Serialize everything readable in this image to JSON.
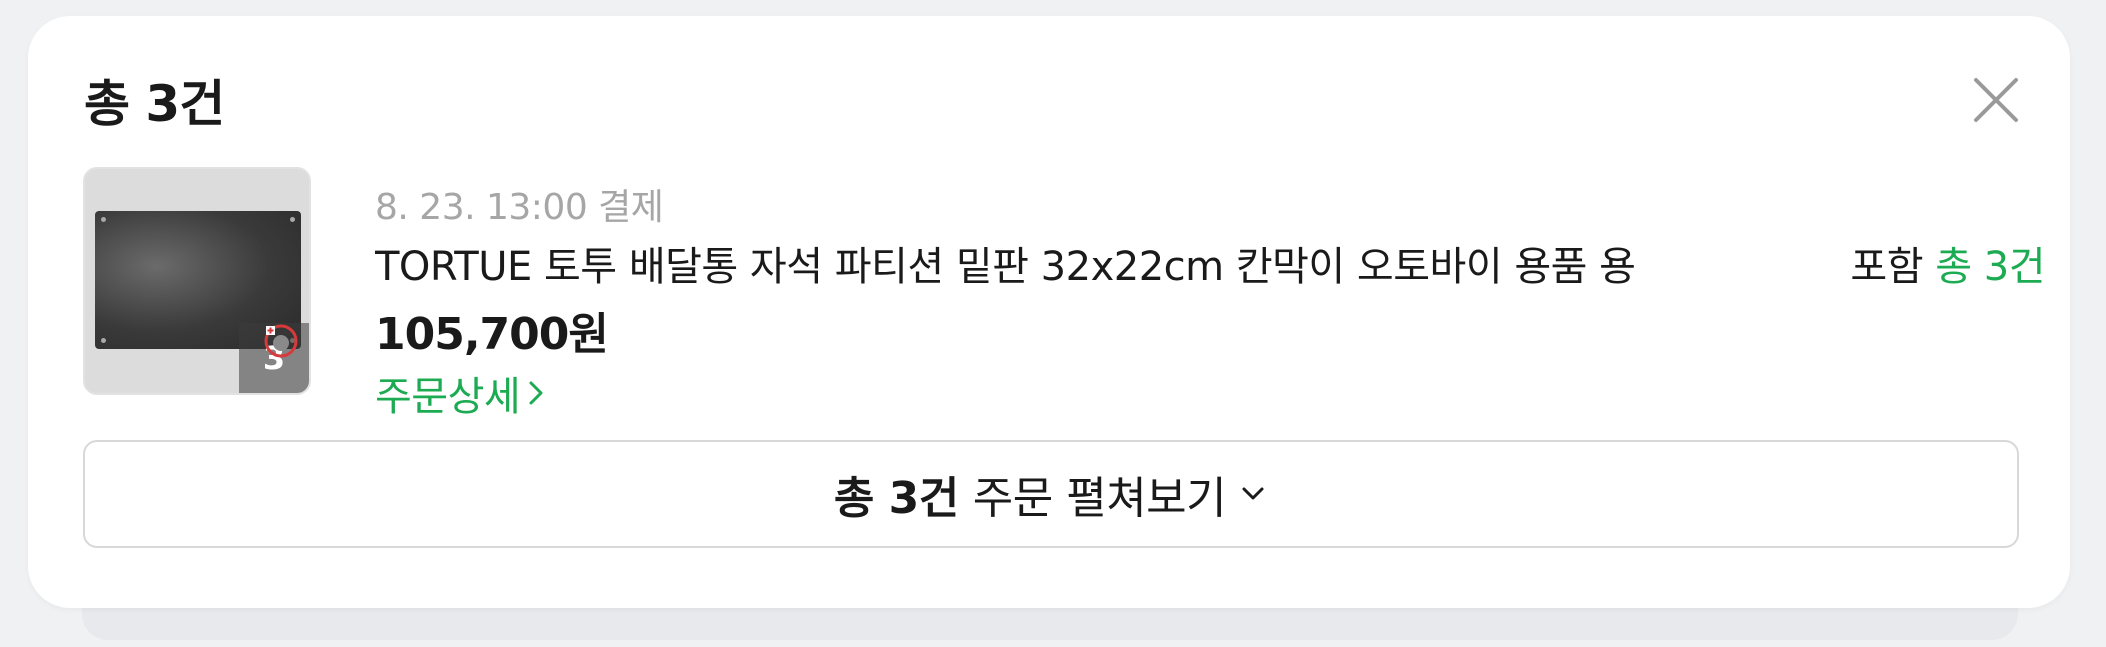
{
  "header": {
    "title": "총 3건"
  },
  "order": {
    "date": "8. 23. 13:00 결제",
    "product_name": "TORTUE 토투 배달통 자석 파티션 밑판 32x22cm 칸막이 오토바이 용품 용",
    "include_prefix": "포함",
    "include_count": "총 3건",
    "price": "105,700원",
    "detail_link": "주문상세",
    "thumbnail_count": "3"
  },
  "expand_button": {
    "bold": "총 3건",
    "text": "주문 펼쳐보기"
  },
  "colors": {
    "accent_green": "#1cab52",
    "muted_text": "#a6a6a6",
    "text": "#1a1a1a"
  },
  "icons": {
    "close": "close-icon",
    "chevron_right": "chevron-right-icon",
    "chevron_down": "chevron-down-icon",
    "badge": "plus-badge-icon"
  }
}
